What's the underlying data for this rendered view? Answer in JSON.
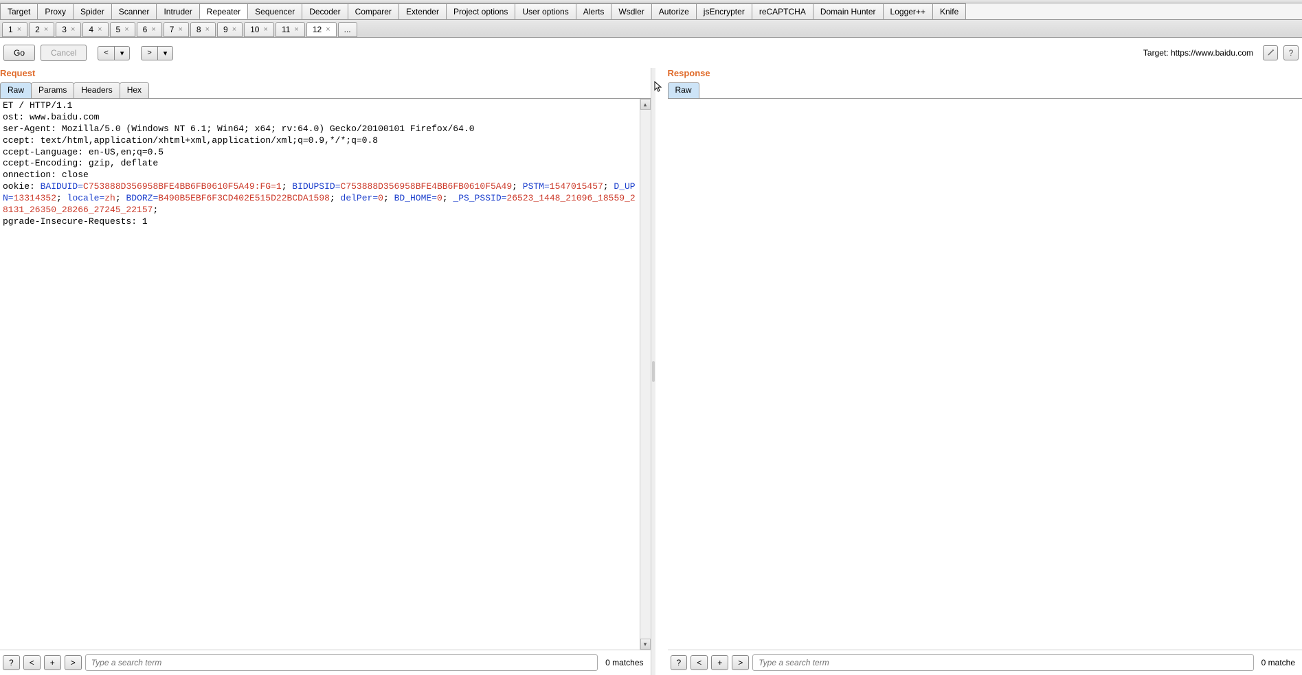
{
  "main_tabs": [
    "Target",
    "Proxy",
    "Spider",
    "Scanner",
    "Intruder",
    "Repeater",
    "Sequencer",
    "Decoder",
    "Comparer",
    "Extender",
    "Project options",
    "User options",
    "Alerts",
    "Wsdler",
    "Autorize",
    "jsEncrypter",
    "reCAPTCHA",
    "Domain Hunter",
    "Logger++",
    "Knife"
  ],
  "main_tab_active": "Repeater",
  "sub_tabs": [
    "1",
    "2",
    "3",
    "4",
    "5",
    "6",
    "7",
    "8",
    "9",
    "10",
    "11",
    "12"
  ],
  "sub_tab_active": "12",
  "toolbar": {
    "go": "Go",
    "cancel": "Cancel",
    "target_label": "Target: https://www.baidu.com"
  },
  "request": {
    "title": "Request",
    "tabs": [
      "Raw",
      "Params",
      "Headers",
      "Hex"
    ],
    "active_tab": "Raw",
    "lines": [
      {
        "t": "plain",
        "v": "ET / HTTP/1.1"
      },
      {
        "t": "plain",
        "v": "ost: www.baidu.com"
      },
      {
        "t": "plain",
        "v": "ser-Agent: Mozilla/5.0 (Windows NT 6.1; Win64; x64; rv:64.0) Gecko/20100101 Firefox/64.0"
      },
      {
        "t": "plain",
        "v": "ccept: text/html,application/xhtml+xml,application/xml;q=0.9,*/*;q=0.8"
      },
      {
        "t": "plain",
        "v": "ccept-Language: en-US,en;q=0.5"
      },
      {
        "t": "plain",
        "v": "ccept-Encoding: gzip, deflate"
      },
      {
        "t": "plain",
        "v": "onnection: close"
      },
      {
        "t": "cookie",
        "prefix": "ookie: ",
        "pairs": [
          {
            "k": "BAIDUID",
            "v": "C753888D356958BFE4BB6FB0610F5A49:FG=1"
          },
          {
            "k": "BIDUPSID",
            "v": "C753888D356958BFE4BB6FB0610F5A49"
          },
          {
            "k": "PSTM",
            "v": "1547015457"
          },
          {
            "k": "D_UPN",
            "v": "13314352"
          },
          {
            "k": "locale",
            "v": "zh"
          },
          {
            "k": "BDORZ",
            "v": "B490B5EBF6F3CD402E515D22BCDA1598"
          },
          {
            "k": "delPer",
            "v": "0"
          },
          {
            "k": "BD_HOME",
            "v": "0"
          },
          {
            "k": "_PS_PSSID",
            "v": "26523_1448_21096_18559_28131_26350_28266_27245_22157"
          }
        ]
      },
      {
        "t": "plain",
        "v": "pgrade-Insecure-Requests: 1"
      }
    ],
    "search_placeholder": "Type a search term",
    "matches": "0 matches"
  },
  "response": {
    "title": "Response",
    "tabs": [
      "Raw"
    ],
    "active_tab": "Raw",
    "search_placeholder": "Type a search term",
    "matches": "0 matche"
  }
}
